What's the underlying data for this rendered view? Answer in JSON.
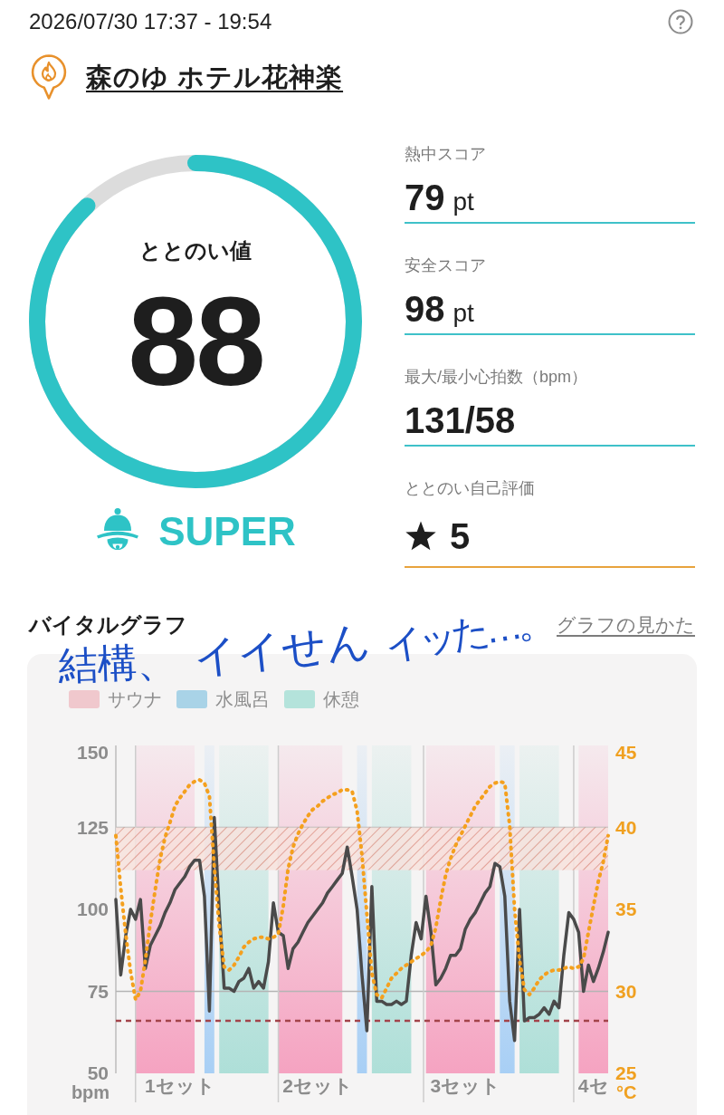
{
  "header": {
    "datetime": "2026/07/30 17:37 - 19:54",
    "facility": "森のゆ ホテル花神楽"
  },
  "score": {
    "label": "ととのい値",
    "value": "88",
    "level": 0.88,
    "rank": "SUPER"
  },
  "metrics": [
    {
      "kind": "score",
      "label": "熱中スコア",
      "value": "79",
      "unit": "pt"
    },
    {
      "kind": "score",
      "label": "安全スコア",
      "value": "98",
      "unit": "pt"
    },
    {
      "kind": "score",
      "label": "最大/最小心拍数（bpm）",
      "value": "131/58"
    },
    {
      "kind": "rating",
      "label": "ととのい自己評価",
      "value": "5"
    }
  ],
  "vital_graph": {
    "title": "バイタルグラフ",
    "help_link": "グラフの見かた",
    "legend": [
      {
        "label": "サウナ",
        "color": "#f0c8cd"
      },
      {
        "label": "水風呂",
        "color": "#a9d3e7"
      },
      {
        "label": "休憩",
        "color": "#b4e3db"
      }
    ],
    "chart_data": {
      "type": "line",
      "ylabel": "bpm",
      "ylim": [
        50,
        150
      ],
      "yticks": [
        50,
        75,
        100,
        125,
        150
      ],
      "y2label": "°C",
      "y2lim": [
        25,
        45
      ],
      "y2ticks": [
        25,
        30,
        35,
        40,
        45
      ],
      "categories": [
        null,
        null,
        null,
        null,
        null,
        null,
        null,
        null,
        null,
        null,
        null,
        null,
        null,
        "1セット",
        null,
        null,
        null,
        null,
        null,
        null,
        null,
        null,
        null,
        null,
        null,
        null,
        null,
        null,
        null,
        null,
        null,
        null,
        null,
        null,
        null,
        null,
        null,
        null,
        null,
        null,
        null,
        "2セット",
        null,
        null,
        null,
        null,
        null,
        null,
        null,
        null,
        null,
        null,
        null,
        null,
        null,
        null,
        null,
        null,
        null,
        null,
        null,
        null,
        null,
        null,
        null,
        null,
        null,
        null,
        null,
        null,
        null,
        "3セット",
        null,
        null,
        null,
        null,
        null,
        null,
        null,
        null,
        null,
        null,
        null,
        null,
        null,
        null,
        null,
        null,
        null,
        null,
        null,
        null,
        null,
        null,
        null,
        null,
        null,
        "4セ",
        null,
        null,
        null
      ],
      "series": [
        {
          "color": "#4a4a4a",
          "values": [
            103,
            80,
            92,
            100,
            97,
            103,
            82,
            89,
            92,
            95,
            99,
            102,
            106,
            108,
            110,
            113,
            115,
            115,
            104,
            69,
            128,
            100,
            76,
            76,
            75,
            78,
            79,
            82,
            76,
            78,
            76,
            84,
            102,
            93,
            92,
            82,
            88,
            90,
            93,
            96,
            98,
            100,
            102,
            105,
            107,
            109,
            111,
            119,
            110,
            100,
            80,
            63,
            107,
            72,
            72,
            71,
            71,
            72,
            71,
            72,
            86,
            96,
            91,
            104,
            93,
            77,
            79,
            82,
            86,
            86,
            88,
            94,
            97,
            99,
            102,
            105,
            107,
            114,
            113,
            104,
            72,
            60,
            100,
            66,
            67,
            67,
            68,
            70,
            68,
            72,
            70,
            86,
            99,
            97,
            93,
            75,
            83,
            78,
            82,
            87,
            93
          ]
        },
        {
          "color": "#f4a01e",
          "axis": "y2",
          "line_style": "dotted",
          "values": [
            39.5,
            36.3,
            33.5,
            31.2,
            29.5,
            30.0,
            31.9,
            34.2,
            36.2,
            38.1,
            39.4,
            40.3,
            41.3,
            41.8,
            42.2,
            42.6,
            42.8,
            42.9,
            42.7,
            41.9,
            37.6,
            34.0,
            31.5,
            31.3,
            31.6,
            32.1,
            32.7,
            33.0,
            33.2,
            33.3,
            33.3,
            33.2,
            33.3,
            33.5,
            35.2,
            37.5,
            38.8,
            39.6,
            40.2,
            40.7,
            41.1,
            41.3,
            41.6,
            41.8,
            42.0,
            42.1,
            42.3,
            42.3,
            42.2,
            41.0,
            38.3,
            34.7,
            31.1,
            29.8,
            29.6,
            30.2,
            30.8,
            31.1,
            31.4,
            31.6,
            31.8,
            32.0,
            32.2,
            32.4,
            32.8,
            33.9,
            35.6,
            37.1,
            38.1,
            38.9,
            39.5,
            40.1,
            40.7,
            41.3,
            41.7,
            42.1,
            42.5,
            42.7,
            42.8,
            42.7,
            40.1,
            35.0,
            31.9,
            30.1,
            29.8,
            30.2,
            30.7,
            31.0,
            31.2,
            31.3,
            31.3,
            31.4,
            31.5,
            31.4,
            31.5,
            32.0,
            33.6,
            35.2,
            36.7,
            37.9,
            39.5
          ]
        }
      ],
      "bands": [
        {
          "axis": "y",
          "from": 112,
          "to": 125,
          "color": "#d98474"
        }
      ],
      "ref_lines": [
        {
          "axis": "y",
          "value": 66
        }
      ]
    }
  },
  "handwritten_note": {
    "parts": [
      "結構、",
      "イイせん",
      "イッた…。"
    ]
  }
}
